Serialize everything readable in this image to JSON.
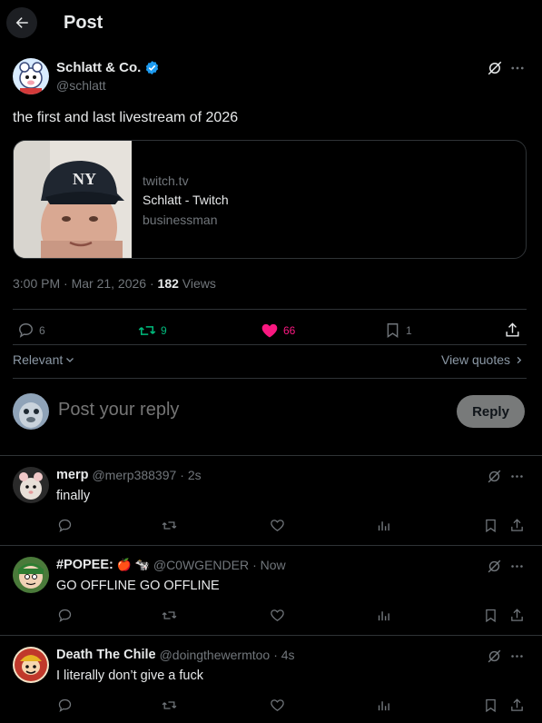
{
  "header": {
    "title": "Post"
  },
  "post": {
    "author_name": "Schlatt & Co.",
    "author_handle": "@schlatt",
    "verified": true,
    "text": "the first and last livestream of 2026",
    "card": {
      "domain": "twitch.tv",
      "title": "Schlatt - Twitch",
      "description": "businessman"
    },
    "time": "3:00 PM · Mar 21, 2026 · ",
    "views_count": "182",
    "views_label": " Views",
    "stats": {
      "replies": "6",
      "reposts": "9",
      "likes": "66",
      "bookmarks": "1"
    }
  },
  "sort": {
    "label": "Relevant",
    "view_quotes": "View quotes"
  },
  "composer": {
    "placeholder": "Post your reply",
    "button": "Reply"
  },
  "replies": [
    {
      "name": "merp",
      "handle": "@merp388397",
      "time": "· 2s",
      "text": "finally"
    },
    {
      "name": "#POPEE:",
      "emoji": "🍎 🐄",
      "handle": "@C0WGENDER",
      "time": "· Now",
      "text": "GO OFFLINE GO OFFLINE"
    },
    {
      "name": "Death The Chile",
      "handle": "@doingthewermtoo",
      "time": "· 4s",
      "text": "I literally don’t give a fuck"
    }
  ],
  "colors": {
    "accent_blue": "#1d9bf0",
    "repost_green": "#00ba7c",
    "like_pink": "#f91880",
    "muted": "#71767b",
    "border": "#2f3336"
  }
}
